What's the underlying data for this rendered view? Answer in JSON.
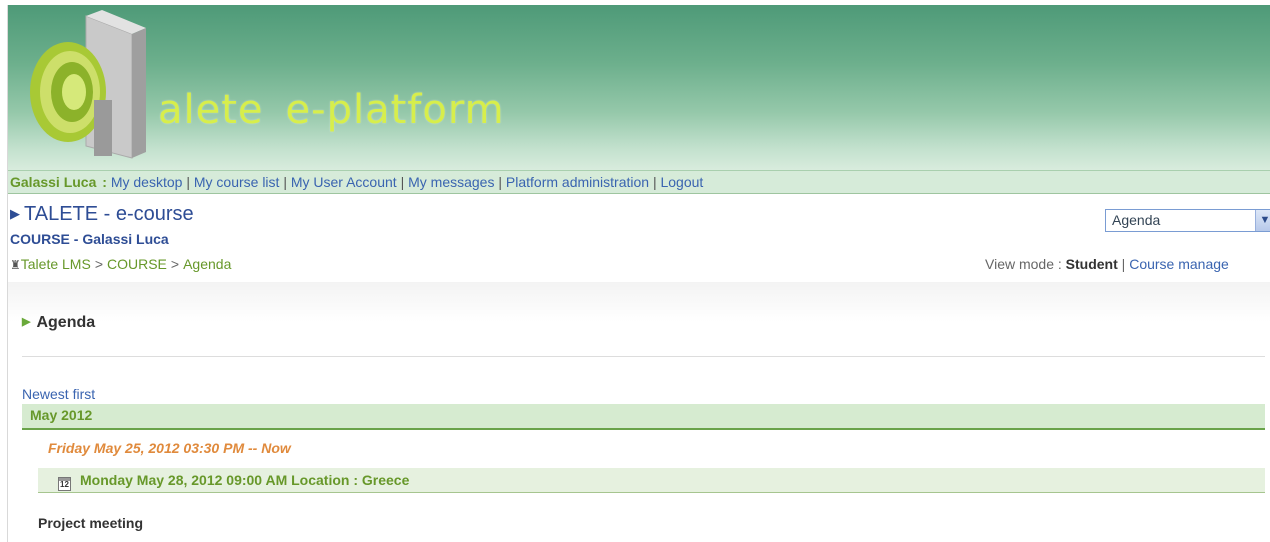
{
  "banner": {
    "logo_text_a": "alete",
    "logo_text_b": "e-platform"
  },
  "usernav": {
    "user_name": "Galassi Luca",
    "name_sep": " : ",
    "links": [
      "My desktop",
      "My course list",
      "My User Account",
      "My messages",
      "Platform administration",
      "Logout"
    ],
    "separator": " | "
  },
  "course": {
    "title": "TALETE - e-course",
    "subtitle": "COURSE - Galassi Luca"
  },
  "tool_select": {
    "value": "Agenda"
  },
  "breadcrumb": {
    "items": [
      "Talete LMS",
      "COURSE",
      "Agenda"
    ],
    "separator": ">"
  },
  "viewmode": {
    "label": "View mode : ",
    "current": "Student",
    "separator": " | ",
    "other": "Course manage"
  },
  "agenda": {
    "title": "Agenda",
    "sort_link": "Newest first",
    "month": "May 2012",
    "event": {
      "when": "Friday May 25, 2012 03:30 PM -- Now",
      "header": "Monday May 28, 2012 09:00 AM Location : Greece",
      "calendar_icon_day": "12",
      "body": "Project meeting"
    }
  },
  "colors": {
    "link_blue": "#3a64b0",
    "brand_green": "#67982a",
    "event_orange": "#e08a3c",
    "banner_green": "#4e9a78",
    "logo_lime": "#d7ee4b"
  },
  "icons": [
    "home-icon",
    "calendar-icon",
    "dropdown-arrow-icon",
    "triangle-bullet-icon"
  ]
}
